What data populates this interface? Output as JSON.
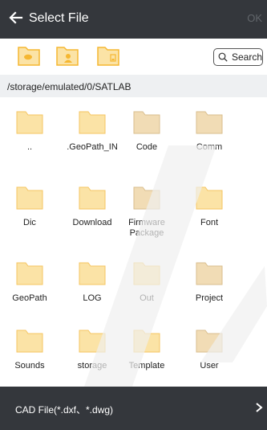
{
  "header": {
    "title": "Select File",
    "ok_label": "OK"
  },
  "toolbar": {
    "search_label": "Search"
  },
  "path": "/storage/emulated/0/SATLAB",
  "folders": [
    {
      "name": "..",
      "shade": "light"
    },
    {
      "name": ".GeoPath_IN",
      "shade": "light"
    },
    {
      "name": "Code",
      "shade": "dark"
    },
    {
      "name": "Comm",
      "shade": "dark"
    },
    {
      "name": "Dic",
      "shade": "light"
    },
    {
      "name": "Download",
      "shade": "light"
    },
    {
      "name": "Firmware\nPackage",
      "shade": "dark"
    },
    {
      "name": "Font",
      "shade": "light"
    },
    {
      "name": "GeoPath",
      "shade": "light"
    },
    {
      "name": "LOG",
      "shade": "light"
    },
    {
      "name": "Out",
      "shade": "light"
    },
    {
      "name": "Project",
      "shade": "dark"
    },
    {
      "name": "Sounds",
      "shade": "light"
    },
    {
      "name": "storage",
      "shade": "light"
    },
    {
      "name": "Template",
      "shade": "light"
    },
    {
      "name": "User",
      "shade": "dark"
    }
  ],
  "filter": {
    "label": "CAD File(*.dxf、*.dwg)"
  },
  "colors": {
    "bar": "#34373c",
    "folder_light": "#fbe3a6",
    "folder_dark": "#f1dcb5",
    "icon_accent": "#f5b731"
  }
}
